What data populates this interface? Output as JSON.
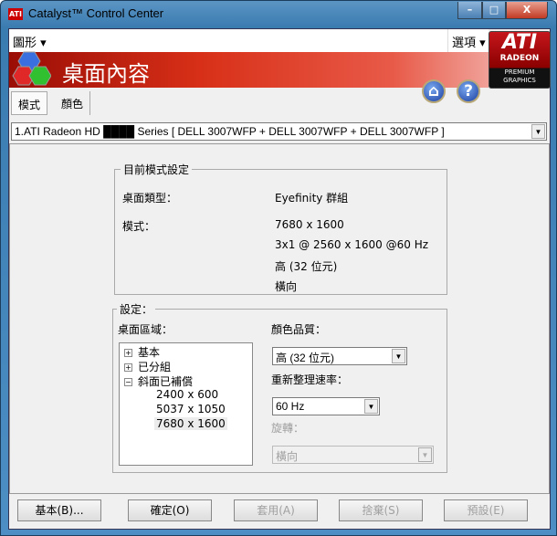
{
  "window": {
    "title": "Catalyst™ Control Center",
    "icon_text": "ATI",
    "minimize": "–",
    "maximize": "□",
    "close": "X"
  },
  "menu": {
    "graphics": "圖形 ▾",
    "options": "選項 ▾"
  },
  "banner": {
    "title": "桌面內容",
    "home": "⌂",
    "help": "?"
  },
  "logo": {
    "brand": "ATI",
    "line1": "RADEON",
    "line2": "PREMIUM",
    "line3": "GRAPHICS"
  },
  "tabs": [
    {
      "label": "模式",
      "selected": true
    },
    {
      "label": "顏色",
      "selected": false
    }
  ],
  "display_select": {
    "value": "1.ATI Radeon HD ████ Series [ DELL 3007WFP + DELL 3007WFP + DELL 3007WFP ]"
  },
  "current": {
    "title": "目前模式設定",
    "desktop_type_label": "桌面類型：",
    "desktop_type": "Eyefinity 群組",
    "mode_label": "模式：",
    "mode_lines": [
      "7680 x 1600",
      "3x1 @ 2560 x 1600 @60 Hz",
      "高 (32 位元)",
      "橫向"
    ]
  },
  "settings": {
    "title": "設定：",
    "area_label": "桌面區域：",
    "tree": [
      {
        "label": "基本",
        "toggle": "+"
      },
      {
        "label": "已分組",
        "toggle": "+"
      },
      {
        "label": "斜面已補償",
        "toggle": "−"
      }
    ],
    "resolutions": [
      "2400 x  600",
      "5037 x 1050",
      "7680 x 1600"
    ],
    "selected_resolution": "7680 x 1600",
    "color_label": "顏色品質：",
    "color_value": "高 (32 位元)",
    "refresh_label": "重新整理速率：",
    "refresh_value": "60 Hz",
    "rotation_label": "旋轉：",
    "rotation_value": "橫向"
  },
  "buttons": {
    "basic": "基本(B)...",
    "ok": "確定(O)",
    "apply": "套用(A)",
    "discard": "捨棄(S)",
    "defaults": "預設(E)"
  }
}
